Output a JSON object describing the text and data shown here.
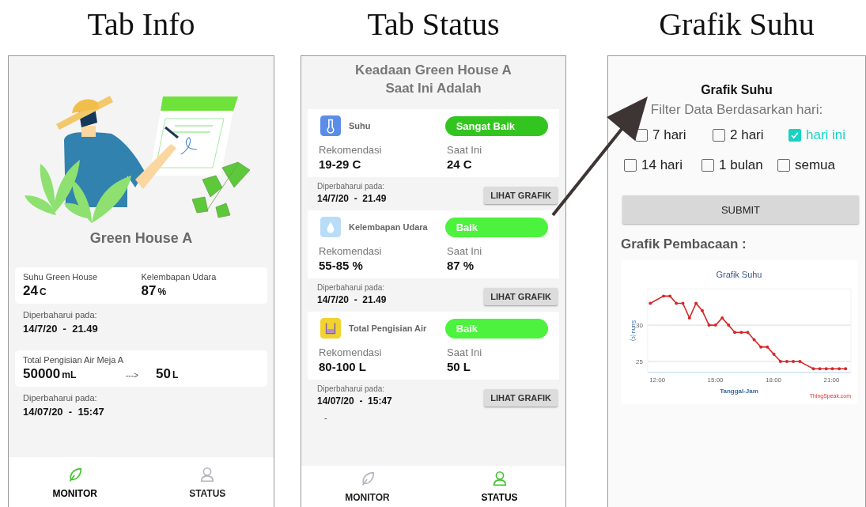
{
  "info_screen": {
    "heading": "Tab Info",
    "title": "Green House A",
    "cards": [
      {
        "kind": "pair",
        "items": [
          {
            "label": "Suhu Green House",
            "value": "24",
            "unit": "C"
          },
          {
            "label": "Kelembapan Udara",
            "value": "87",
            "unit": "%"
          }
        ],
        "updated_label": "Diperbaharui pada:",
        "updated_value": "14/7/20  -  21.49"
      },
      {
        "kind": "conversion",
        "label": "Total Pengisian Air Meja A",
        "value": "50000",
        "unit": "mL",
        "arrow": "--->",
        "converted_value": "50",
        "converted_unit": "L",
        "updated_label": "Diperbaharui pada:",
        "updated_value": "14/07/20  -  15:47"
      }
    ],
    "nav": [
      {
        "label": "MONITOR",
        "selected": true
      },
      {
        "label": "STATUS",
        "selected": false
      }
    ]
  },
  "status_screen": {
    "heading": "Tab Status",
    "title_lines": [
      "Keadaan Green House A",
      "Saat Ini Adalah"
    ],
    "items": [
      {
        "name": "Suhu",
        "status": "Sangat Baik",
        "color": "#33c51f",
        "rec_label": "Rekomendasi",
        "rec_value": "19-29 C",
        "now_label": "Saat Ini",
        "now_value": "24 C",
        "updated_label": "Diperbaharui pada:",
        "updated_value": "14/7/20  -  21.49",
        "button": "LIHAT GRAFIK"
      },
      {
        "name": "Kelembapan Udara",
        "status": "Baik",
        "color": "#4cf23e",
        "rec_label": "Rekomendasi",
        "rec_value": "55-85 %",
        "now_label": "Saat Ini",
        "now_value": "87 %",
        "updated_label": "Diperbaharui pada:",
        "updated_value": "14/7/20  -  21.49",
        "button": "LIHAT GRAFIK"
      },
      {
        "name": "Total Pengisian Air",
        "status": "Baik",
        "color": "#4cf23e",
        "rec_label": "Rekomendasi",
        "rec_value": "80-100 L",
        "now_label": "Saat Ini",
        "now_value": "50 L",
        "updated_label": "Diperbaharui pada:",
        "updated_value": "14/07/20  -  15:47",
        "button": "LIHAT GRAFIK"
      }
    ],
    "trailing_text": "-",
    "nav": [
      {
        "label": "MONITOR",
        "selected": false
      },
      {
        "label": "STATUS",
        "selected": true
      }
    ]
  },
  "chart_screen": {
    "heading": "Grafik Suhu",
    "title": "Grafik Suhu",
    "filter_label": "Filter Data Berdasarkan hari:",
    "options": [
      {
        "label": "7 hari",
        "checked": false
      },
      {
        "label": "2 hari",
        "checked": false
      },
      {
        "label": "hari ini",
        "checked": true
      },
      {
        "label": "14 hari",
        "checked": false
      },
      {
        "label": "1 bulan",
        "checked": false
      },
      {
        "label": "semua",
        "checked": false
      }
    ],
    "submit": "SUBMIT",
    "section_title": "Grafik Pembacaan :",
    "credit": "ThingSpeak.com",
    "chart_data": {
      "type": "line",
      "title": "Grafik Suhu",
      "xlabel": "Tanggal-Jam",
      "ylabel": "Suhu (c)",
      "xlim": [
        11.5,
        22
      ],
      "ylim": [
        23.5,
        35
      ],
      "xticks": [
        {
          "value": 12,
          "label": "12:00"
        },
        {
          "value": 15,
          "label": "15:00"
        },
        {
          "value": 18,
          "label": "18:00"
        },
        {
          "value": 21,
          "label": "21:00"
        }
      ],
      "yticks": [
        25,
        30
      ],
      "x": [
        11.64,
        12.32,
        12.65,
        12.98,
        13.32,
        13.66,
        14.0,
        14.32,
        14.67,
        15.01,
        15.35,
        15.68,
        16.0,
        16.34,
        16.67,
        17.0,
        17.35,
        17.68,
        18.02,
        18.36,
        18.69,
        19.02,
        19.36,
        20.06,
        20.39,
        20.72,
        21.04,
        21.39,
        21.72
      ],
      "series": [
        {
          "color": "#d62728",
          "values": [
            33,
            34,
            34,
            33,
            33,
            31,
            33,
            32,
            30,
            30,
            31,
            30,
            29,
            29,
            29,
            28,
            27,
            27,
            26,
            25,
            25,
            25,
            25,
            24,
            24,
            24,
            24,
            24,
            24
          ]
        }
      ]
    }
  }
}
